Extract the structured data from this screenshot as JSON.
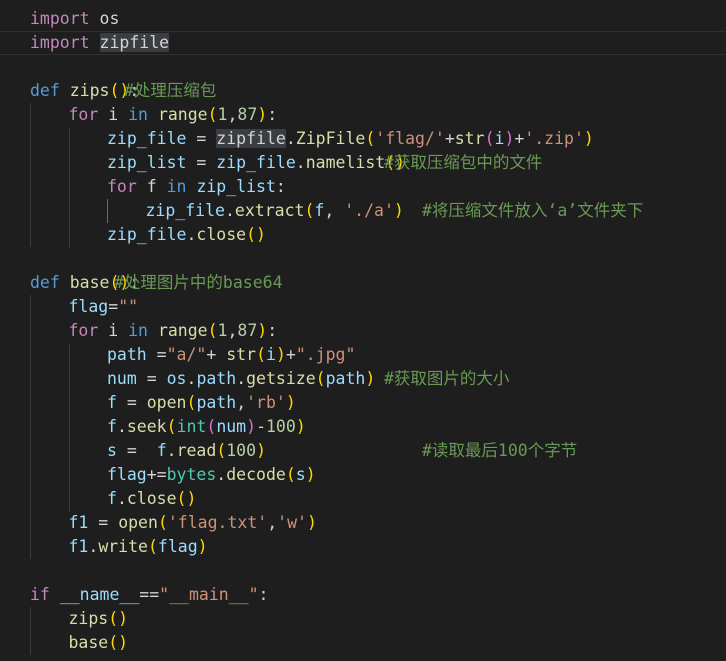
{
  "editor": {
    "lines": [
      {
        "indent": 0,
        "tokens": [
          [
            "import",
            "kw2"
          ],
          [
            " os",
            "op"
          ]
        ],
        "comment": ""
      },
      {
        "indent": 0,
        "active": true,
        "tokens": [
          [
            "import",
            "kw2"
          ],
          [
            " ",
            "op"
          ],
          [
            "zipfile",
            "hl"
          ]
        ],
        "comment": ""
      },
      {
        "indent": 0,
        "tokens": [],
        "comment": ""
      },
      {
        "indent": 0,
        "tokens": [
          [
            "def",
            "kw"
          ],
          [
            " ",
            "op"
          ],
          [
            "zips",
            "fn"
          ],
          [
            "()",
            "p1"
          ],
          [
            ":",
            "op"
          ]
        ],
        "comment": "#处理压缩包",
        "comment_col": 124
      },
      {
        "indent": 1,
        "tokens": [
          [
            "for",
            "kw2"
          ],
          [
            " i ",
            "op"
          ],
          [
            "in",
            "kw"
          ],
          [
            " ",
            "op"
          ],
          [
            "range",
            "fn"
          ],
          [
            "(",
            "p1"
          ],
          [
            "1",
            "num"
          ],
          [
            ",",
            "op"
          ],
          [
            "87",
            "num"
          ],
          [
            ")",
            "p1"
          ],
          [
            ":",
            "op"
          ]
        ],
        "comment": ""
      },
      {
        "indent": 2,
        "tokens": [
          [
            "zip_file",
            "var"
          ],
          [
            " = ",
            "op"
          ],
          [
            "zipfile",
            "hl"
          ],
          [
            ".",
            "op"
          ],
          [
            "ZipFile",
            "fn"
          ],
          [
            "(",
            "p1"
          ],
          [
            "'flag/'",
            "str"
          ],
          [
            "+",
            "op"
          ],
          [
            "str",
            "fn"
          ],
          [
            "(",
            "p2"
          ],
          [
            "i",
            "var"
          ],
          [
            ")",
            "p2"
          ],
          [
            "+",
            "op"
          ],
          [
            "'.zip'",
            "str"
          ],
          [
            ")",
            "p1"
          ]
        ],
        "comment": ""
      },
      {
        "indent": 2,
        "tokens": [
          [
            "zip_list",
            "var"
          ],
          [
            " = ",
            "op"
          ],
          [
            "zip_file",
            "var"
          ],
          [
            ".",
            "op"
          ],
          [
            "namelist",
            "fn"
          ],
          [
            "()",
            "p1"
          ]
        ],
        "comment": "#获取压缩包中的文件",
        "comment_col": 384
      },
      {
        "indent": 2,
        "tokens": [
          [
            "for",
            "kw2"
          ],
          [
            " f ",
            "op"
          ],
          [
            "in",
            "kw"
          ],
          [
            " ",
            "op"
          ],
          [
            "zip_list",
            "var"
          ],
          [
            ":",
            "op"
          ]
        ],
        "comment": ""
      },
      {
        "indent": 3,
        "tokens": [
          [
            "zip_file",
            "var"
          ],
          [
            ".",
            "op"
          ],
          [
            "extract",
            "fn"
          ],
          [
            "(",
            "p1"
          ],
          [
            "f",
            "var"
          ],
          [
            ", ",
            "op"
          ],
          [
            "'./a'",
            "str"
          ],
          [
            ")",
            "p1"
          ]
        ],
        "comment": "#将压缩文件放入‘a’文件夹下",
        "comment_col": 422
      },
      {
        "indent": 2,
        "tokens": [
          [
            "zip_file",
            "var"
          ],
          [
            ".",
            "op"
          ],
          [
            "close",
            "fn"
          ],
          [
            "()",
            "p1"
          ]
        ],
        "comment": ""
      },
      {
        "indent": 0,
        "tokens": [],
        "comment": ""
      },
      {
        "indent": 0,
        "tokens": [
          [
            "def",
            "kw"
          ],
          [
            " ",
            "op"
          ],
          [
            "base",
            "fn"
          ],
          [
            "()",
            "p1"
          ],
          [
            ":",
            "op"
          ]
        ],
        "comment": "#处理图片中的base64",
        "comment_col": 114
      },
      {
        "indent": 1,
        "tokens": [
          [
            "flag",
            "var"
          ],
          [
            "=",
            "op"
          ],
          [
            "\"\"",
            "str"
          ]
        ],
        "comment": ""
      },
      {
        "indent": 1,
        "tokens": [
          [
            "for",
            "kw2"
          ],
          [
            " i ",
            "op"
          ],
          [
            "in",
            "kw"
          ],
          [
            " ",
            "op"
          ],
          [
            "range",
            "fn"
          ],
          [
            "(",
            "p1"
          ],
          [
            "1",
            "num"
          ],
          [
            ",",
            "op"
          ],
          [
            "87",
            "num"
          ],
          [
            ")",
            "p1"
          ],
          [
            ":",
            "op"
          ]
        ],
        "comment": ""
      },
      {
        "indent": 2,
        "tokens": [
          [
            "path",
            "var"
          ],
          [
            " =",
            "op"
          ],
          [
            "\"a/\"",
            "str"
          ],
          [
            "+ ",
            "op"
          ],
          [
            "str",
            "fn"
          ],
          [
            "(",
            "p1"
          ],
          [
            "i",
            "var"
          ],
          [
            ")",
            "p1"
          ],
          [
            "+",
            "op"
          ],
          [
            "\".jpg\"",
            "str"
          ]
        ],
        "comment": ""
      },
      {
        "indent": 2,
        "tokens": [
          [
            "num",
            "var"
          ],
          [
            " = ",
            "op"
          ],
          [
            "os",
            "var"
          ],
          [
            ".",
            "op"
          ],
          [
            "path",
            "var"
          ],
          [
            ".",
            "op"
          ],
          [
            "getsize",
            "fn"
          ],
          [
            "(",
            "p1"
          ],
          [
            "path",
            "var"
          ],
          [
            ")",
            "p1"
          ]
        ],
        "comment": "#获取图片的大小",
        "comment_col": 384
      },
      {
        "indent": 2,
        "tokens": [
          [
            "f",
            "var"
          ],
          [
            " = ",
            "op"
          ],
          [
            "open",
            "fn"
          ],
          [
            "(",
            "p1"
          ],
          [
            "path",
            "var"
          ],
          [
            ",",
            "op"
          ],
          [
            "'rb'",
            "str"
          ],
          [
            ")",
            "p1"
          ]
        ],
        "comment": ""
      },
      {
        "indent": 2,
        "tokens": [
          [
            "f",
            "var"
          ],
          [
            ".",
            "op"
          ],
          [
            "seek",
            "fn"
          ],
          [
            "(",
            "p1"
          ],
          [
            "int",
            "cls"
          ],
          [
            "(",
            "p2"
          ],
          [
            "num",
            "var"
          ],
          [
            ")",
            "p2"
          ],
          [
            "-",
            "op"
          ],
          [
            "100",
            "num"
          ],
          [
            ")",
            "p1"
          ]
        ],
        "comment": ""
      },
      {
        "indent": 2,
        "tokens": [
          [
            "s",
            "var"
          ],
          [
            " =  ",
            "op"
          ],
          [
            "f",
            "var"
          ],
          [
            ".",
            "op"
          ],
          [
            "read",
            "fn"
          ],
          [
            "(",
            "p1"
          ],
          [
            "100",
            "num"
          ],
          [
            ")",
            "p1"
          ]
        ],
        "comment": "#读取最后100个字节",
        "comment_col": 422
      },
      {
        "indent": 2,
        "tokens": [
          [
            "flag",
            "var"
          ],
          [
            "+=",
            "op"
          ],
          [
            "bytes",
            "cls"
          ],
          [
            ".",
            "op"
          ],
          [
            "decode",
            "fn"
          ],
          [
            "(",
            "p1"
          ],
          [
            "s",
            "var"
          ],
          [
            ")",
            "p1"
          ]
        ],
        "comment": ""
      },
      {
        "indent": 2,
        "tokens": [
          [
            "f",
            "var"
          ],
          [
            ".",
            "op"
          ],
          [
            "close",
            "fn"
          ],
          [
            "()",
            "p1"
          ]
        ],
        "comment": ""
      },
      {
        "indent": 1,
        "tokens": [
          [
            "f1",
            "var"
          ],
          [
            " = ",
            "op"
          ],
          [
            "open",
            "fn"
          ],
          [
            "(",
            "p1"
          ],
          [
            "'flag.txt'",
            "str"
          ],
          [
            ",",
            "op"
          ],
          [
            "'w'",
            "str"
          ],
          [
            ")",
            "p1"
          ]
        ],
        "comment": ""
      },
      {
        "indent": 1,
        "tokens": [
          [
            "f1",
            "var"
          ],
          [
            ".",
            "op"
          ],
          [
            "write",
            "fn"
          ],
          [
            "(",
            "p1"
          ],
          [
            "flag",
            "var"
          ],
          [
            ")",
            "p1"
          ]
        ],
        "comment": ""
      },
      {
        "indent": 0,
        "tokens": [],
        "comment": ""
      },
      {
        "indent": 0,
        "tokens": [
          [
            "if",
            "kw2"
          ],
          [
            " ",
            "op"
          ],
          [
            "__name__",
            "var"
          ],
          [
            "==",
            "op"
          ],
          [
            "\"__main__\"",
            "str"
          ],
          [
            ":",
            "op"
          ]
        ],
        "comment": ""
      },
      {
        "indent": 1,
        "tokens": [
          [
            "zips",
            "fn"
          ],
          [
            "()",
            "p1"
          ]
        ],
        "comment": ""
      },
      {
        "indent": 1,
        "tokens": [
          [
            "base",
            "fn"
          ],
          [
            "()",
            "p1"
          ]
        ],
        "comment": ""
      }
    ]
  }
}
